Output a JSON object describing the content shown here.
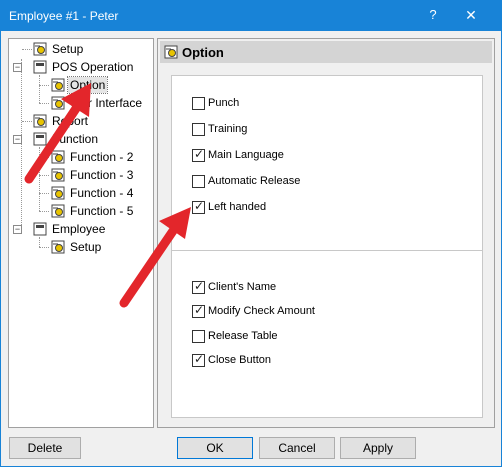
{
  "window": {
    "title": "Employee #1 - Peter",
    "help_glyph": "?",
    "close_glyph": "✕"
  },
  "tree": {
    "items": [
      {
        "label": "Setup"
      },
      {
        "label": "POS Operation"
      },
      {
        "label": "Option"
      },
      {
        "label": "Ular Interface"
      },
      {
        "label": "Report"
      },
      {
        "label": "Function"
      },
      {
        "label": "Function - 2"
      },
      {
        "label": "Function - 3"
      },
      {
        "label": "Function - 4"
      },
      {
        "label": "Function - 5"
      },
      {
        "label": "Employee"
      },
      {
        "label": "Setup"
      }
    ]
  },
  "panel": {
    "title": "Option",
    "group1": [
      {
        "label": "Punch",
        "checked": false
      },
      {
        "label": "Training",
        "checked": false
      },
      {
        "label": "Main Language",
        "checked": true
      },
      {
        "label": "Automatic Release",
        "checked": false
      },
      {
        "label": "Left handed",
        "checked": true
      }
    ],
    "group2": [
      {
        "label": "Client's Name",
        "checked": true
      },
      {
        "label": "Modify Check Amount",
        "checked": true
      },
      {
        "label": "Release Table",
        "checked": false
      },
      {
        "label": "Close Button",
        "checked": true
      }
    ]
  },
  "buttons": {
    "delete": "Delete",
    "ok": "OK",
    "cancel": "Cancel",
    "apply": "Apply"
  },
  "colors": {
    "titlebar": "#1883d7",
    "arrow": "#e3262b"
  }
}
